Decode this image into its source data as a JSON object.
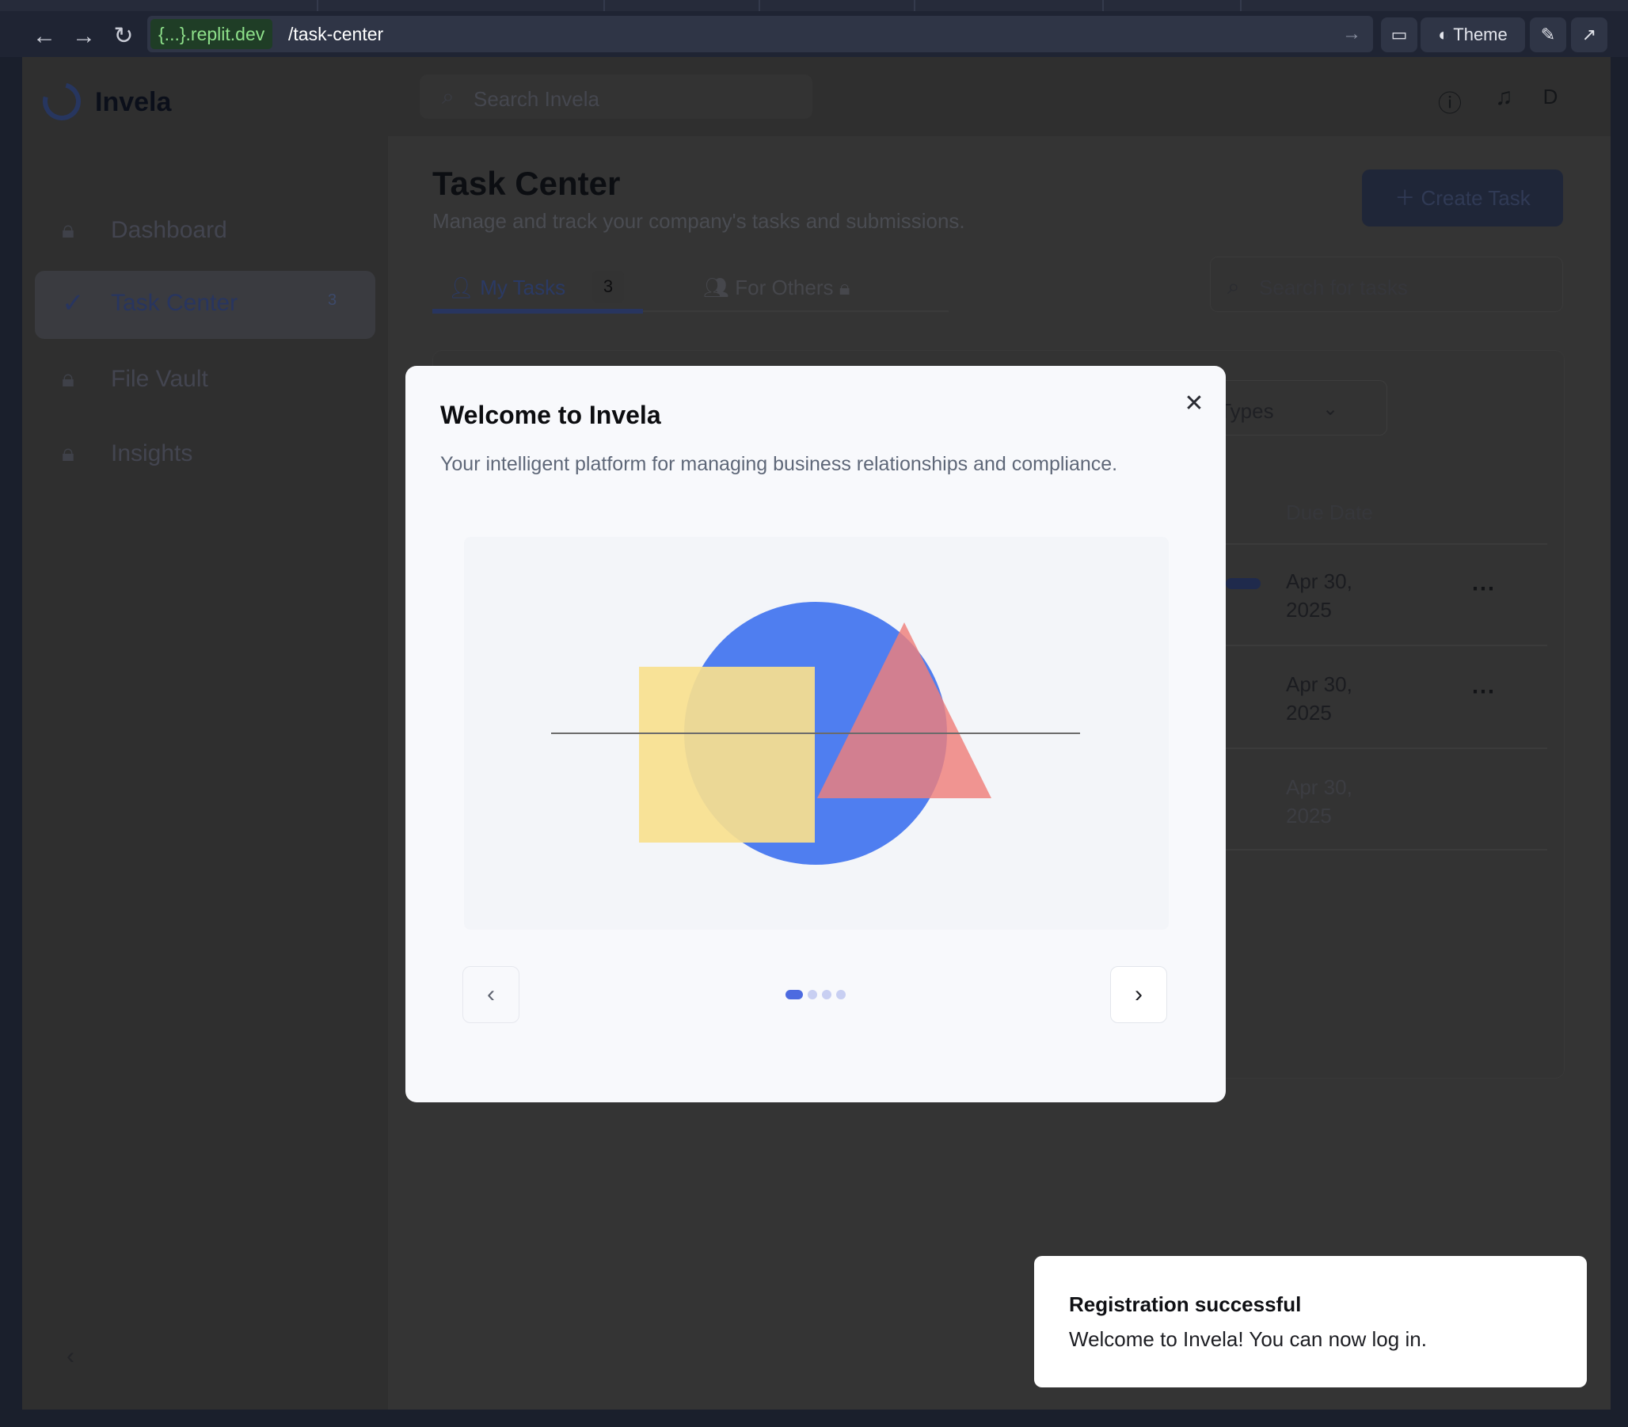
{
  "browser": {
    "domain": "{...}.replit.dev",
    "path": "/task-center",
    "theme_label": "Theme"
  },
  "app": {
    "brand": "Invela",
    "header_search_placeholder": "Search Invela",
    "avatar_initial": "D"
  },
  "sidebar": {
    "items": [
      {
        "label": "Dashboard",
        "icon": "lock-icon"
      },
      {
        "label": "Task Center",
        "icon": "check-circle-icon",
        "badge": "3"
      },
      {
        "label": "File Vault",
        "icon": "lock-icon"
      },
      {
        "label": "Insights",
        "icon": "lock-icon"
      }
    ]
  },
  "page": {
    "title": "Task Center",
    "subtitle": "Manage and track your company's tasks and submissions.",
    "create_task_label": "Create Task",
    "tabs": [
      {
        "label": "My Tasks",
        "badge": "3"
      },
      {
        "label": "For Others"
      }
    ],
    "task_search_placeholder": "Search for tasks",
    "types_filter_label": "e Types",
    "columns": [
      "s",
      "Due Date"
    ],
    "rows": [
      {
        "due_line1": "Apr 30,",
        "due_line2": "2025"
      },
      {
        "due_line1": "Apr 30,",
        "due_line2": "2025"
      },
      {
        "due_line1": "Apr 30,",
        "due_line2": "2025"
      }
    ]
  },
  "modal": {
    "title": "Welcome to Invela",
    "subtitle": "Your intelligent platform for managing business relationships and compliance.",
    "slide_index": 1,
    "slide_count": 4
  },
  "toast": {
    "title": "Registration successful",
    "message": "Welcome to Invela! You can now log in."
  },
  "colors": {
    "accent": "#4d6be0",
    "circle": "#4f7ef0",
    "square": "#f8e08e",
    "triangle": "#ef7f7a"
  }
}
